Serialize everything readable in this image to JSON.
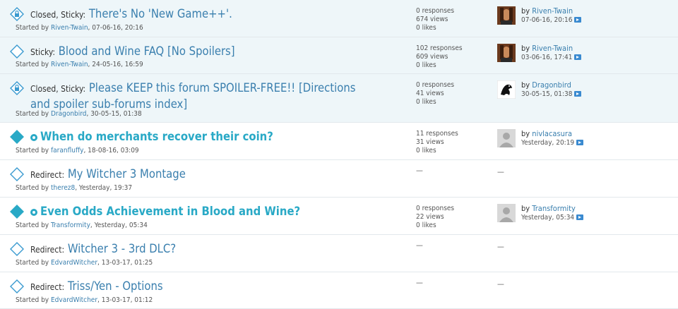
{
  "threads": [
    {
      "prefix": "Closed, Sticky:",
      "title": "There's No 'New Game++'.",
      "started_label": "Started by",
      "author": "Riven-Twain",
      "started": ", 07-06-16, 20:16",
      "responses": "0 responses",
      "views": "674 views",
      "likes": "0 likes",
      "last_by_label": "by",
      "last_by": "Riven-Twain",
      "last_date": "07-06-16, 20:16",
      "avatar": "witcher-portrait",
      "icon": "closed-sticky-icon"
    },
    {
      "prefix": "Sticky:",
      "title": "Blood and Wine FAQ [No Spoilers]",
      "started_label": "Started by",
      "author": "Riven-Twain",
      "started": ", 24-05-16, 16:59",
      "responses": "102 responses",
      "views": "609 views",
      "likes": "0 likes",
      "last_by_label": "by",
      "last_by": "Riven-Twain",
      "last_date": "03-06-16, 17:41",
      "avatar": "witcher-portrait",
      "icon": "diamond-icon"
    },
    {
      "prefix": "Closed, Sticky:",
      "title": "Please KEEP this forum SPOILER-FREE!! [Directions and spoiler sub-forums index]",
      "started_label": "Started by",
      "author": "Dragonbird",
      "started": ", 30-05-15, 01:38",
      "responses": "0 responses",
      "views": "41 views",
      "likes": "0 likes",
      "last_by_label": "by",
      "last_by": "Dragonbird",
      "last_date": "30-05-15, 01:38",
      "avatar": "dragon-logo",
      "icon": "closed-sticky-icon"
    },
    {
      "prefix": "",
      "title": "When do merchants recover their coin?",
      "started_label": "Started by",
      "author": "faranfluffy",
      "started": ", 18-08-16, 03:09",
      "responses": "11 responses",
      "views": "31 views",
      "likes": "0 likes",
      "last_by_label": "by",
      "last_by": "nivlacasura",
      "last_date": "Yesterday, 20:19",
      "avatar": "default-avatar",
      "icon": "filled-diamond-icon"
    },
    {
      "prefix": "Redirect:",
      "title": "My Witcher 3 Montage",
      "started_label": "Started by",
      "author": "therez8",
      "started": ", Yesterday, 19:37",
      "stats_dash": "—",
      "last_dash": "—",
      "icon": "diamond-icon"
    },
    {
      "prefix": "",
      "title": "Even Odds Achievement in Blood and Wine?",
      "started_label": "Started by",
      "author": "Transformity",
      "started": ", Yesterday, 05:34",
      "responses": "0 responses",
      "views": "22 views",
      "likes": "0 likes",
      "last_by_label": "by",
      "last_by": "Transformity",
      "last_date": "Yesterday, 05:34",
      "avatar": "default-avatar",
      "icon": "filled-diamond-icon"
    },
    {
      "prefix": "Redirect:",
      "title": "Witcher 3 - 3rd DLC?",
      "started_label": "Started by",
      "author": "EdvardWitcher",
      "started": ", 13-03-17, 01:25",
      "stats_dash": "—",
      "last_dash": "—",
      "icon": "diamond-icon"
    },
    {
      "prefix": "Redirect:",
      "title": "Triss/Yen - Options",
      "started_label": "Started by",
      "author": "EdvardWitcher",
      "started": ", 13-03-17, 01:12",
      "stats_dash": "—",
      "last_dash": "—",
      "icon": "diamond-icon"
    }
  ],
  "colors": {
    "sticky_bg": "#eef6f9",
    "link": "#3a7fae",
    "hot_title": "#29a9c6",
    "divider": "#e2e8ec"
  }
}
